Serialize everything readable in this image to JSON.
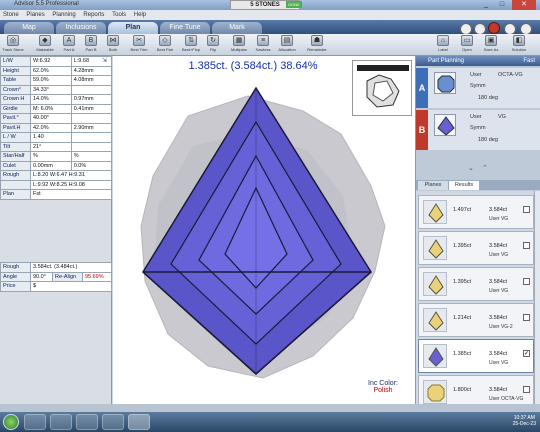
{
  "window": {
    "title": "Advisor 5.5 Professional",
    "center_title": "5 STONES",
    "badge": "DONE"
  },
  "menu": [
    "Stone",
    "Planes",
    "Planning",
    "Reports",
    "Tools",
    "Help"
  ],
  "tabs": [
    {
      "label": "Map",
      "active": false
    },
    {
      "label": "Inclusions",
      "active": false
    },
    {
      "label": "Plan",
      "active": true
    },
    {
      "label": "Fine Tune",
      "active": false
    },
    {
      "label": "Mark",
      "active": false
    }
  ],
  "toolbar": {
    "left": [
      "Track Stone",
      "Makeable",
      "Part A",
      "Part B",
      "Both",
      "Best Trim",
      "Best Pair",
      "Best+Flop",
      "Flip",
      "Multiplan",
      "Sawless",
      "Allocation",
      "Remainder"
    ],
    "right": [
      "Label",
      "Open",
      "Save As",
      "Solution"
    ]
  },
  "parameters": [
    {
      "k": "L/W",
      "a": "W:6.92",
      "b": "L:9.68"
    },
    {
      "k": "Height",
      "a": "62.0%",
      "b": "4.28mm"
    },
    {
      "k": "Table",
      "a": "59.0%",
      "b": "4.08mm"
    },
    {
      "k": "Crown°",
      "a": "34.33°",
      "b": ""
    },
    {
      "k": "Crown H",
      "a": "14.0%",
      "b": "0.97mm"
    },
    {
      "k": "Girdle",
      "a": "M: 6.0%",
      "b": "0.41mm"
    },
    {
      "k": "Pavil.°",
      "a": "40.00°",
      "b": ""
    },
    {
      "k": "Pavil.H",
      "a": "42.0%",
      "b": "2.90mm"
    },
    {
      "k": "L / W",
      "a": "1.40",
      "b": ""
    },
    {
      "k": "Tilt",
      "a": "21°",
      "b": ""
    },
    {
      "k": "Star/Half",
      "a": "%",
      "b": "%"
    },
    {
      "k": "Culet",
      "a": "0.00mm",
      "b": "0.0%"
    },
    {
      "k": "Rough",
      "a": "L:8.20 W:6.47 H:9.31",
      "b": ""
    },
    {
      "k": "",
      "a": "L:9.92 W:8.25 H:9.08",
      "b": ""
    },
    {
      "k": "Plan",
      "a": "Fst",
      "b": ""
    }
  ],
  "summary": {
    "rough_label": "Rough",
    "rough_value": "3.584ct. (3.484ct.)",
    "angle_label": "Angle",
    "angle_value": "90.0°",
    "realign_label": "Re-Align",
    "realign_value": "95.69%",
    "price_label": "Price",
    "price_value": "$"
  },
  "canvas": {
    "headline": "1.385ct. (3.584ct.) 38.64%",
    "inc_color_label": "Inc Color:",
    "inc_color_value": "Polish"
  },
  "part_planning": {
    "title": "Part Planning",
    "mode": "Fast",
    "plans": [
      {
        "letter": "A",
        "user": "User",
        "cut": "OCTA-VG",
        "symm": "Symm",
        "deg": "180 deg",
        "color": "#3d6fb8"
      },
      {
        "letter": "B",
        "user": "User",
        "cut": "VG",
        "symm": "Symm",
        "deg": "180 deg",
        "color": "#c0392b"
      }
    ],
    "subtabs": [
      "Planes",
      "Results"
    ]
  },
  "results": [
    {
      "ct": "1.497ct",
      "total": "3.584ct",
      "user": "User VG",
      "checked": false
    },
    {
      "ct": "1.395ct",
      "total": "3.584ct",
      "user": "User VG",
      "checked": false
    },
    {
      "ct": "1.395ct",
      "total": "3.584ct",
      "user": "User VG",
      "checked": false
    },
    {
      "ct": "1.214ct",
      "total": "3.584ct",
      "user": "User VG-2",
      "checked": false
    },
    {
      "ct": "1.385ct",
      "total": "3.584ct",
      "user": "User VG",
      "checked": true,
      "selected": true
    },
    {
      "ct": "1.800ct",
      "total": "3.584ct",
      "user": "User OCTA-VG",
      "checked": false
    }
  ],
  "clock": {
    "time": "10:37 AM",
    "date": "25-Dec-23"
  }
}
